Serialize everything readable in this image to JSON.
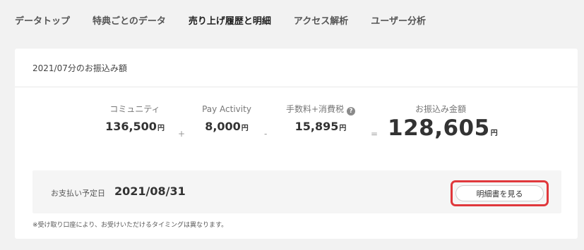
{
  "tabs": [
    {
      "label": "データトップ"
    },
    {
      "label": "特典ごとのデータ"
    },
    {
      "label": "売り上げ履歴と明細"
    },
    {
      "label": "アクセス解析"
    },
    {
      "label": "ユーザー分析"
    }
  ],
  "active_tab": "売り上げ履歴と明細",
  "card": {
    "title": "2021/07分のお振込み額",
    "summary": {
      "community": {
        "label": "コミュニティ",
        "value": "136,500",
        "unit": "円"
      },
      "plus": "+",
      "pay_activity": {
        "label": "Pay Activity",
        "value": "8,000",
        "unit": "円"
      },
      "minus": "-",
      "fees": {
        "label": "手数料+消費税",
        "value": "15,895",
        "unit": "円",
        "help_icon": "question-circle-icon",
        "help_glyph": "?"
      },
      "equals": "=",
      "transfer": {
        "label": "お振込み金額",
        "value": "128,605",
        "unit": "円"
      }
    },
    "payment": {
      "label": "お支払い予定日",
      "date": "2021/08/31",
      "button_label": "明細書を見る"
    },
    "note": "※受け取り口座により、お受けいただけるタイミングは異なります。"
  },
  "colors": {
    "background": "#f2f2f2",
    "card": "#ffffff",
    "highlight": "#e0383c"
  }
}
